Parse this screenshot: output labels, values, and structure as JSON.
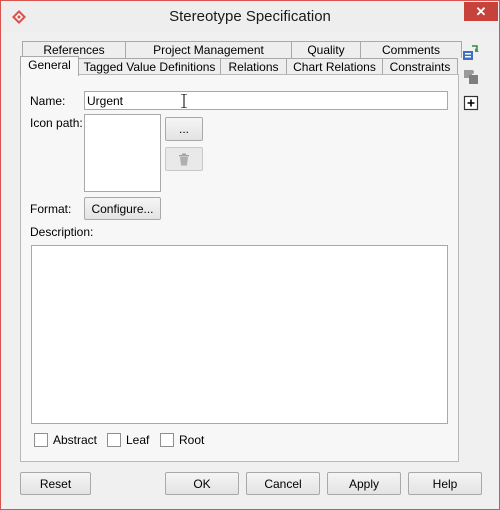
{
  "window": {
    "title": "Stereotype Specification",
    "close_glyph": "✕"
  },
  "tabs_back": [
    {
      "label": "References"
    },
    {
      "label": "Project Management"
    },
    {
      "label": "Quality"
    },
    {
      "label": "Comments"
    }
  ],
  "tabs_front": [
    {
      "label": "General",
      "active": true
    },
    {
      "label": "Tagged Value Definitions"
    },
    {
      "label": "Relations"
    },
    {
      "label": "Chart Relations"
    },
    {
      "label": "Constraints"
    }
  ],
  "form": {
    "name_label": "Name:",
    "name_value": "Urgent",
    "icon_path_label": "Icon path:",
    "browse_label": "...",
    "format_label": "Format:",
    "configure_label": "Configure...",
    "description_label": "Description:",
    "description_value": ""
  },
  "checkboxes": [
    {
      "label": "Abstract",
      "checked": false
    },
    {
      "label": "Leaf",
      "checked": false
    },
    {
      "label": "Root",
      "checked": false
    }
  ],
  "buttons": {
    "reset": "Reset",
    "ok": "OK",
    "cancel": "Cancel",
    "apply": "Apply",
    "help": "Help"
  },
  "side_icons": [
    "add-constraint-icon",
    "puzzle-icon",
    "expand-icon"
  ],
  "colors": {
    "close": "#c7423b",
    "accent": "#d9534f"
  }
}
